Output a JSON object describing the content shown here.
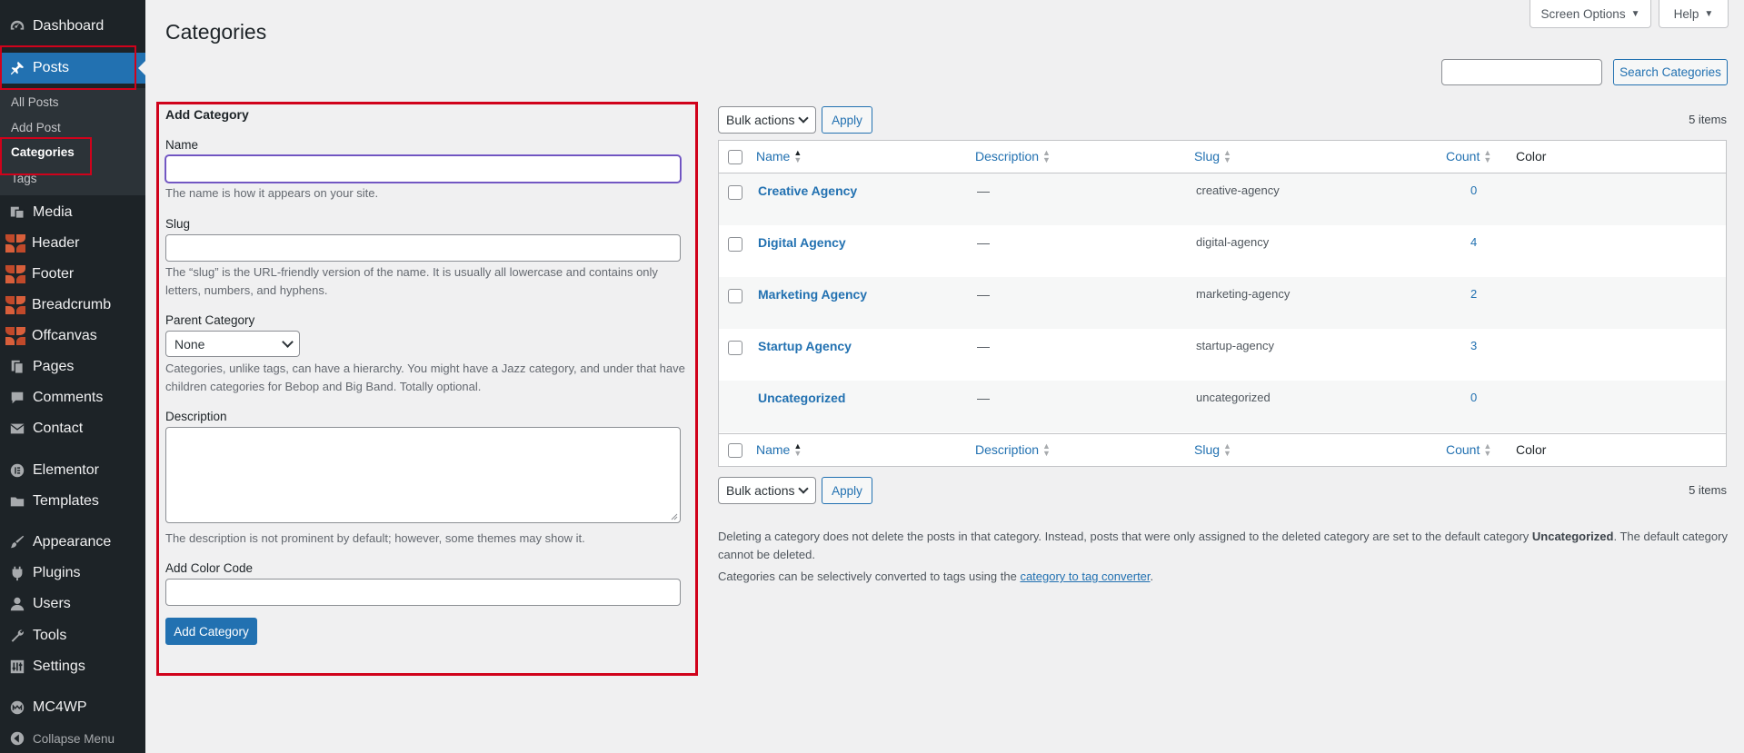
{
  "sidebar": {
    "items": [
      {
        "key": "dashboard",
        "label": "Dashboard",
        "icon": "dashboard-icon"
      },
      {
        "key": "posts",
        "label": "Posts",
        "icon": "pushpin-icon"
      },
      {
        "key": "media",
        "label": "Media",
        "icon": "media-icon"
      },
      {
        "key": "header",
        "label": "Header",
        "icon": "elementor-kit-icon"
      },
      {
        "key": "footer",
        "label": "Footer",
        "icon": "elementor-kit-icon"
      },
      {
        "key": "breadcrumb",
        "label": "Breadcrumb",
        "icon": "elementor-kit-icon"
      },
      {
        "key": "offcanvas",
        "label": "Offcanvas",
        "icon": "elementor-kit-icon"
      },
      {
        "key": "pages",
        "label": "Pages",
        "icon": "pages-icon"
      },
      {
        "key": "comments",
        "label": "Comments",
        "icon": "comments-icon"
      },
      {
        "key": "contact",
        "label": "Contact",
        "icon": "mail-icon"
      },
      {
        "key": "elementor",
        "label": "Elementor",
        "icon": "elementor-icon"
      },
      {
        "key": "templates",
        "label": "Templates",
        "icon": "folder-icon"
      },
      {
        "key": "appearance",
        "label": "Appearance",
        "icon": "paintbrush-icon"
      },
      {
        "key": "plugins",
        "label": "Plugins",
        "icon": "plug-icon"
      },
      {
        "key": "users",
        "label": "Users",
        "icon": "user-icon"
      },
      {
        "key": "tools",
        "label": "Tools",
        "icon": "wrench-icon"
      },
      {
        "key": "settings",
        "label": "Settings",
        "icon": "settings-sliders-icon"
      },
      {
        "key": "mc4wp",
        "label": "MC4WP",
        "icon": "mc4wp-icon"
      },
      {
        "key": "collapse",
        "label": "Collapse Menu",
        "icon": "collapse-icon"
      }
    ],
    "submenu": [
      "All Posts",
      "Add Post",
      "Categories",
      "Tags"
    ]
  },
  "topbar": {
    "screen_options": "Screen Options",
    "help": "Help"
  },
  "page_title": "Categories",
  "search": {
    "button": "Search Categories",
    "value": ""
  },
  "form": {
    "heading": "Add Category",
    "name_label": "Name",
    "name_help": "The name is how it appears on your site.",
    "slug_label": "Slug",
    "slug_help_1": "The “slug” is the URL-friendly version of the name. It is usually all lowercase and contains only",
    "slug_help_2": "letters, numbers, and hyphens.",
    "parent_label": "Parent Category",
    "parent_value": "None",
    "parent_help_1": "Categories, unlike tags, can have a hierarchy. You might have a Jazz category, and under that have",
    "parent_help_2": "children categories for Bebop and Big Band. Totally optional.",
    "description_label": "Description",
    "description_help": "The description is not prominent by default; however, some themes may show it.",
    "color_label": "Add Color Code",
    "submit": "Add Category"
  },
  "table": {
    "bulk_actions": "Bulk actions",
    "apply": "Apply",
    "item_count": "5 items",
    "columns": {
      "name": "Name",
      "description": "Description",
      "slug": "Slug",
      "count": "Count",
      "color": "Color"
    },
    "rows": [
      {
        "name": "Creative Agency",
        "description": "—",
        "slug": "creative-agency",
        "count": "0"
      },
      {
        "name": "Digital Agency",
        "description": "—",
        "slug": "digital-agency",
        "count": "4"
      },
      {
        "name": "Marketing Agency",
        "description": "—",
        "slug": "marketing-agency",
        "count": "2"
      },
      {
        "name": "Startup Agency",
        "description": "—",
        "slug": "startup-agency",
        "count": "3"
      },
      {
        "name": "Uncategorized",
        "description": "—",
        "slug": "uncategorized",
        "count": "0"
      }
    ]
  },
  "notes": {
    "delete_1": "Deleting a category does not delete the posts in that category. Instead, posts that were only assigned to the deleted category are set to the default category",
    "delete_bold": "Uncategorized",
    "delete_2": ". The default category",
    "delete_3": "cannot be deleted.",
    "convert_1": "Categories can be selectively converted to tags using the",
    "convert_link": "category to tag converter",
    "convert_2": "."
  },
  "colors": {
    "sidebar_bg": "#1d2327",
    "accent": "#2271b1",
    "highlight": "#d0021b",
    "page_bg": "#f0f0f1"
  }
}
